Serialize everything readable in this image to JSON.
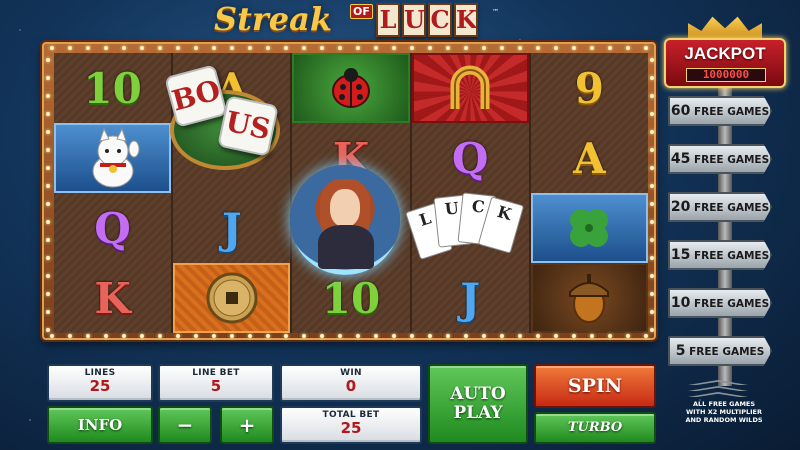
{
  "game": {
    "logo": {
      "word1": "Streak",
      "of": "OF",
      "luck_letters": [
        "L",
        "U",
        "C",
        "K"
      ],
      "tm": "™"
    }
  },
  "reels": {
    "symbols": [
      [
        "10",
        "lucky-cat",
        "Q",
        "K"
      ],
      [
        "A",
        "dice",
        "J",
        "coin"
      ],
      [
        "ladybug",
        "K",
        "wild-lady",
        "10"
      ],
      [
        "horseshoe",
        "Q",
        "cards",
        "J"
      ],
      [
        "9",
        "A",
        "clover",
        "acorn"
      ]
    ],
    "dice_letters": [
      "BO",
      "US"
    ],
    "card_letters": [
      "L",
      "U",
      "C",
      "K"
    ]
  },
  "controls": {
    "lines_label": "LINES",
    "lines_value": "25",
    "line_bet_label": "LINE BET",
    "line_bet_value": "5",
    "win_label": "WIN",
    "win_value": "0",
    "total_bet_label": "TOTAL BET",
    "total_bet_value": "25",
    "info_label": "INFO",
    "minus_label": "−",
    "plus_label": "+",
    "autoplay_line1": "AUTO",
    "autoplay_line2": "PLAY",
    "spin_label": "SPIN",
    "turbo_label": "TURBO"
  },
  "jackpot": {
    "title": "JACKPOT",
    "value": "1000000",
    "rungs": [
      {
        "num": "60",
        "text": "FREE GAMES"
      },
      {
        "num": "45",
        "text": "FREE GAMES"
      },
      {
        "num": "20",
        "text": "FREE GAMES"
      },
      {
        "num": "15",
        "text": "FREE GAMES"
      },
      {
        "num": "10",
        "text": "FREE GAMES"
      },
      {
        "num": "5",
        "text": "FREE GAMES"
      }
    ],
    "note_line1": "ALL FREE GAMES",
    "note_line2": "WITH X2 MULTIPLIER",
    "note_line3": "AND RANDOM WILDS"
  },
  "colors": {
    "spin": "#c82a14",
    "green_button": "#1f8a1f",
    "accent_gold": "#f2c033"
  }
}
